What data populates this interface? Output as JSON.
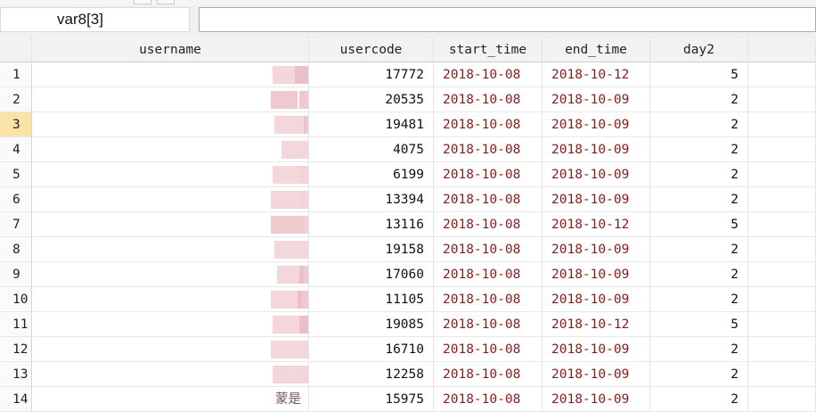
{
  "toolbar": {
    "variable_name": "var8[3]",
    "cell_value": ""
  },
  "table": {
    "columns": [
      "",
      "username",
      "usercode",
      "start_time",
      "end_time",
      "day2",
      ""
    ],
    "selected_row": 3,
    "rows": [
      {
        "n": "1",
        "username": "",
        "usercode": "17772",
        "start_time": "2018-10-08",
        "end_time": "2018-10-12",
        "day2": "5"
      },
      {
        "n": "2",
        "username": "",
        "usercode": "20535",
        "start_time": "2018-10-08",
        "end_time": "2018-10-09",
        "day2": "2"
      },
      {
        "n": "3",
        "username": "",
        "usercode": "19481",
        "start_time": "2018-10-08",
        "end_time": "2018-10-09",
        "day2": "2"
      },
      {
        "n": "4",
        "username": "",
        "usercode": "4075",
        "start_time": "2018-10-08",
        "end_time": "2018-10-09",
        "day2": "2"
      },
      {
        "n": "5",
        "username": "",
        "usercode": "6199",
        "start_time": "2018-10-08",
        "end_time": "2018-10-09",
        "day2": "2"
      },
      {
        "n": "6",
        "username": "",
        "usercode": "13394",
        "start_time": "2018-10-08",
        "end_time": "2018-10-09",
        "day2": "2"
      },
      {
        "n": "7",
        "username": "",
        "usercode": "13116",
        "start_time": "2018-10-08",
        "end_time": "2018-10-12",
        "day2": "5"
      },
      {
        "n": "8",
        "username": "",
        "usercode": "19158",
        "start_time": "2018-10-08",
        "end_time": "2018-10-09",
        "day2": "2"
      },
      {
        "n": "9",
        "username": "",
        "usercode": "17060",
        "start_time": "2018-10-08",
        "end_time": "2018-10-09",
        "day2": "2"
      },
      {
        "n": "10",
        "username": "",
        "usercode": "11105",
        "start_time": "2018-10-08",
        "end_time": "2018-10-09",
        "day2": "2"
      },
      {
        "n": "11",
        "username": "",
        "usercode": "19085",
        "start_time": "2018-10-08",
        "end_time": "2018-10-12",
        "day2": "5"
      },
      {
        "n": "12",
        "username": "",
        "usercode": "16710",
        "start_time": "2018-10-08",
        "end_time": "2018-10-09",
        "day2": "2"
      },
      {
        "n": "13",
        "username": "",
        "usercode": "12258",
        "start_time": "2018-10-08",
        "end_time": "2018-10-09",
        "day2": "2"
      },
      {
        "n": "14",
        "username": "蒙是",
        "usercode": "15975",
        "start_time": "2018-10-08",
        "end_time": "2018-10-09",
        "day2": "2"
      }
    ]
  },
  "colors": {
    "date_text": "#8b1a1a",
    "selected_row_highlight": "#fbe2a7",
    "header_bg": "#f2f2f2"
  }
}
